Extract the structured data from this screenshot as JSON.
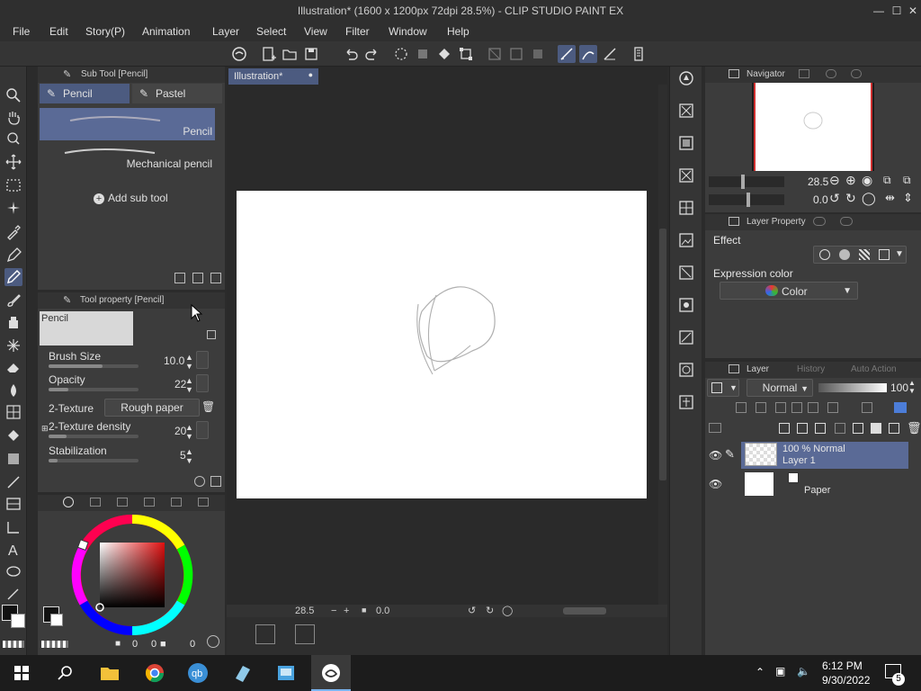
{
  "window": {
    "title": "Illustration* (1600 x 1200px 72dpi 28.5%) - CLIP STUDIO PAINT EX"
  },
  "menu": [
    "File",
    "Edit",
    "Story(P)",
    "Animation",
    "Layer",
    "Select",
    "View",
    "Filter",
    "Window",
    "Help"
  ],
  "sub_tool_panel": {
    "title": "Sub Tool [Pencil]",
    "tabs": [
      "Pencil",
      "Pastel"
    ],
    "items": [
      "Pencil",
      "Mechanical pencil"
    ],
    "add_label": "Add sub tool"
  },
  "tool_property": {
    "title": "Tool property [Pencil]",
    "preview_label": "Pencil",
    "brush_size_label": "Brush Size",
    "brush_size_value": "10.0",
    "opacity_label": "Opacity",
    "opacity_value": "22",
    "texture_label": "2-Texture",
    "texture_value": "Rough paper",
    "texture_density_label": "2-Texture density",
    "texture_density_value": "20",
    "stabilization_label": "Stabilization",
    "stabilization_value": "5"
  },
  "color_panel": {
    "value_a": "0",
    "value_b": "0",
    "value_c": "0"
  },
  "canvas": {
    "tab_label": "Illustration*",
    "zoom": "28.5",
    "angle": "0.0"
  },
  "navigator": {
    "title": "Navigator",
    "zoom": "28.5",
    "angle": "0.0"
  },
  "layer_property": {
    "title": "Layer Property",
    "effect_label": "Effect",
    "expression_label": "Expression color",
    "expression_value": "Color"
  },
  "layer_panel": {
    "tabs": [
      "Layer",
      "History",
      "Auto Action"
    ],
    "blend_mode": "Normal",
    "opacity": "100",
    "layers": [
      {
        "info": "100 % Normal",
        "name": "Layer 1"
      },
      {
        "info": "",
        "name": "Paper"
      }
    ]
  },
  "taskbar": {
    "time": "6:12 PM",
    "date": "9/30/2022",
    "notifications": "5"
  }
}
